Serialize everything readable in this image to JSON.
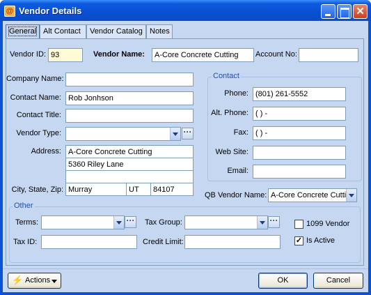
{
  "window": {
    "title": "Vendor Details",
    "app_icon_glyph": "@"
  },
  "tabs": [
    "General",
    "Alt Contact",
    "Vendor Catalog",
    "Notes"
  ],
  "vendor": {
    "id_label": "Vendor ID:",
    "id_value": "93",
    "name_label": "Vendor Name:",
    "name_value": "A-Core Concrete Cutting",
    "account_label": "Account No:",
    "account_value": ""
  },
  "company": {
    "company_name_label": "Company Name:",
    "company_name_value": "",
    "contact_name_label": "Contact Name:",
    "contact_name_value": "Rob Jonhson",
    "contact_title_label": "Contact Title:",
    "contact_title_value": "",
    "vendor_type_label": "Vendor Type:",
    "vendor_type_value": "",
    "address_label": "Address:",
    "address_lines": [
      "A-Core Concrete Cutting",
      "5360 Riley Lane",
      ""
    ],
    "city_state_zip_label": "City, State, Zip:",
    "city": "Murray",
    "state": "UT",
    "zip": "84107"
  },
  "contact": {
    "group_title": "Contact",
    "phone_label": "Phone:",
    "phone_value": "(801) 261-5552",
    "alt_phone_label": "Alt. Phone:",
    "alt_phone_value": "(   )    -",
    "fax_label": "Fax:",
    "fax_value": "(   )    -",
    "website_label": "Web Site:",
    "website_value": "",
    "email_label": "Email:",
    "email_value": ""
  },
  "qb": {
    "label": "QB Vendor Name:",
    "value": "A-Core Concrete Cutti"
  },
  "other": {
    "group_title": "Other",
    "terms_label": "Terms:",
    "terms_value": "",
    "tax_group_label": "Tax Group:",
    "tax_group_value": "",
    "tax_id_label": "Tax ID:",
    "tax_id_value": "",
    "credit_limit_label": "Credit Limit:",
    "credit_limit_value": "",
    "vendor_1099_label": "1099 Vendor",
    "vendor_1099_checked": false,
    "is_active_label": "Is Active",
    "is_active_checked": true,
    "check_glyph": "✓"
  },
  "buttons": {
    "actions": "Actions",
    "ok": "OK",
    "cancel": "Cancel",
    "ellipsis": "···",
    "close_glyph": "✕"
  },
  "colors": {
    "titlebar": "#0a4fd2",
    "client_bg": "#c5d7f1",
    "group_title": "#1f4fb5",
    "vendor_id_bg": "#fefbd7"
  }
}
